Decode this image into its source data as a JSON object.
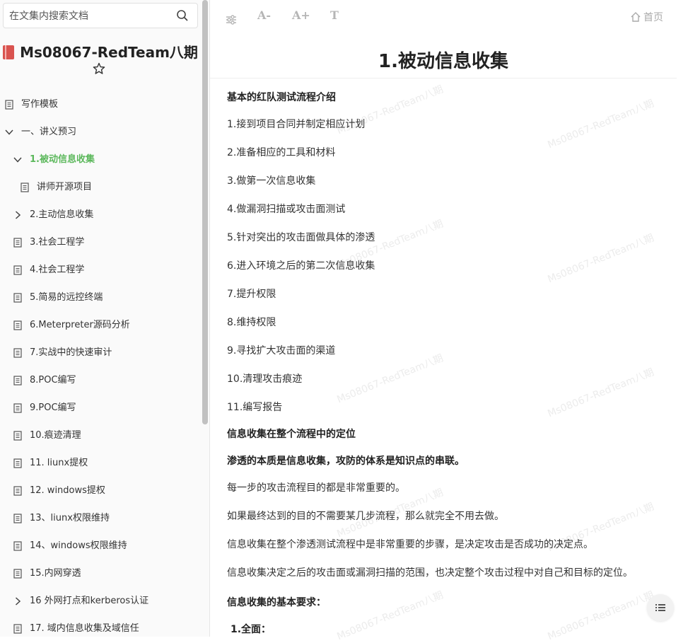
{
  "sidebar": {
    "search_placeholder": "在文集内搜索文档",
    "book_title": "Ms08067-RedTeam八期",
    "items": [
      {
        "label": "写作模板",
        "icon": "document-icon"
      },
      {
        "label": "一、讲义预习",
        "icon": "chevron-down-icon"
      },
      {
        "label": "1.被动信息收集",
        "icon": "chevron-down-icon",
        "active": true
      },
      {
        "label": "讲师开源项目",
        "icon": "document-icon"
      },
      {
        "label": "2.主动信息收集",
        "icon": "chevron-right-icon"
      },
      {
        "label": "3.社会工程学",
        "icon": "document-icon"
      },
      {
        "label": "4.社会工程学",
        "icon": "document-icon"
      },
      {
        "label": "5.简易的远控终端",
        "icon": "document-icon"
      },
      {
        "label": "6.Meterpreter源码分析",
        "icon": "document-icon"
      },
      {
        "label": "7.实战中的快速审计",
        "icon": "document-icon"
      },
      {
        "label": "8.POC编写",
        "icon": "document-icon"
      },
      {
        "label": "9.POC编写",
        "icon": "document-icon"
      },
      {
        "label": "10.痕迹清理",
        "icon": "document-icon"
      },
      {
        "label": "11. liunx提权",
        "icon": "document-icon"
      },
      {
        "label": "12. windows提权",
        "icon": "document-icon"
      },
      {
        "label": "13、liunx权限维持",
        "icon": "document-icon"
      },
      {
        "label": "14、windows权限维持",
        "icon": "document-icon"
      },
      {
        "label": "15.内网穿透",
        "icon": "document-icon"
      },
      {
        "label": "16 外网打点和kerberos认证",
        "icon": "chevron-right-icon"
      },
      {
        "label": "17. 域内信息收集及域信任",
        "icon": "document-icon"
      }
    ]
  },
  "toolbar": {
    "settings_icon": "sliders-icon",
    "font_smaller": "A-",
    "font_larger": "A+",
    "font_style": "T",
    "home_label": "首页"
  },
  "doc": {
    "title": "1.被动信息收集",
    "watermark": "Ms08067-RedTeam八期",
    "paragraphs": [
      {
        "text": "基本的红队测试流程介绍",
        "bold": true
      },
      {
        "text": "1.接到项目合同并制定相应计划"
      },
      {
        "text": "2.准备相应的工具和材料"
      },
      {
        "text": "3.做第一次信息收集"
      },
      {
        "text": "4.做漏洞扫描或攻击面测试"
      },
      {
        "text": "5.针对突出的攻击面做具体的渗透"
      },
      {
        "text": "6.进入环境之后的第二次信息收集"
      },
      {
        "text": "7.提升权限"
      },
      {
        "text": "8.维持权限"
      },
      {
        "text": "9.寻找扩大攻击面的渠道"
      },
      {
        "text": "10.清理攻击痕迹"
      },
      {
        "text": "11.编写报告"
      },
      {
        "text": "信息收集在整个流程中的定位",
        "bold": true
      },
      {
        "text": "渗透的本质是信息收集，攻防的体系是知识点的串联。",
        "bold": true
      },
      {
        "text": "每一步的攻击流程目的都是非常重要的。"
      },
      {
        "text": "如果最终达到的目的不需要某几步流程，那么就完全不用去做。"
      },
      {
        "text": "信息收集在整个渗透测试流程中是非常重要的步骤，是决定攻击是否成功的决定点。"
      },
      {
        "text": "信息收集决定之后的攻击面或漏洞扫描的范围，也决定整个攻击过程中对自己和目标的定位。"
      },
      {
        "text": "信息收集的基本要求：",
        "bold": true
      },
      {
        "text": "1.全面：",
        "bold": true
      }
    ]
  },
  "colors": {
    "active": "#5cb85c",
    "sidebar_bg": "#fafafa",
    "book_icon": "#d9534f"
  }
}
